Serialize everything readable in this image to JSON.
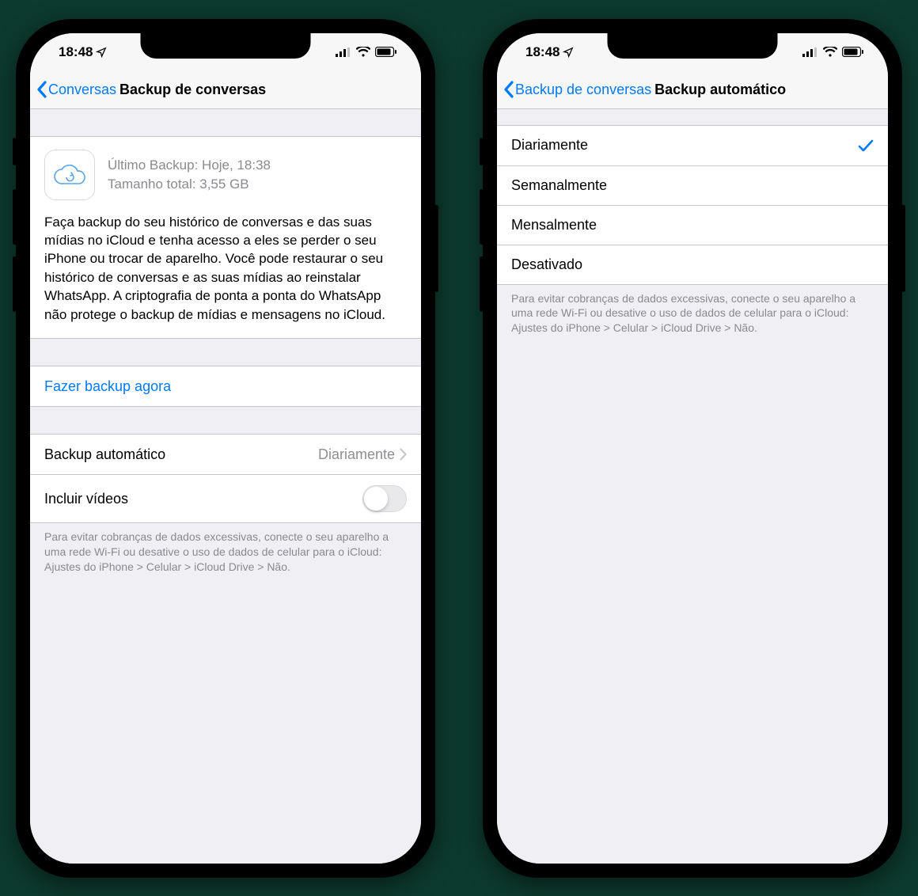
{
  "status": {
    "time": "18:48"
  },
  "left": {
    "nav": {
      "back": "Conversas",
      "title": "Backup de conversas"
    },
    "info": {
      "last_backup": "Último Backup: Hoje, 18:38",
      "total_size": "Tamanho total: 3,55 GB",
      "body": "Faça backup do seu histórico de conversas e das suas mídias no iCloud e tenha acesso a eles se perder o seu iPhone ou trocar de aparelho. Você pode restaurar o seu histórico de conversas e as suas mídias ao reinstalar WhatsApp. A criptografia de ponta a ponta do WhatsApp não protege o backup de mídias e mensagens no iCloud."
    },
    "backup_now": "Fazer backup agora",
    "auto_backup": {
      "label": "Backup automático",
      "value": "Diariamente"
    },
    "include_videos": {
      "label": "Incluir vídeos",
      "on": false
    },
    "footer": "Para evitar cobranças de dados excessivas, conecte o seu aparelho a uma rede Wi-Fi ou desative o uso de dados de celular para o iCloud: Ajustes do iPhone > Celular > iCloud Drive > Não."
  },
  "right": {
    "nav": {
      "back": "Backup de conversas",
      "title": "Backup automático"
    },
    "options": [
      {
        "label": "Diariamente",
        "selected": true
      },
      {
        "label": "Semanalmente",
        "selected": false
      },
      {
        "label": "Mensalmente",
        "selected": false
      },
      {
        "label": "Desativado",
        "selected": false
      }
    ],
    "footer": "Para evitar cobranças de dados excessivas, conecte o seu aparelho a uma rede Wi-Fi ou desative o uso de dados de celular para o iCloud: Ajustes do iPhone > Celular > iCloud Drive > Não."
  }
}
